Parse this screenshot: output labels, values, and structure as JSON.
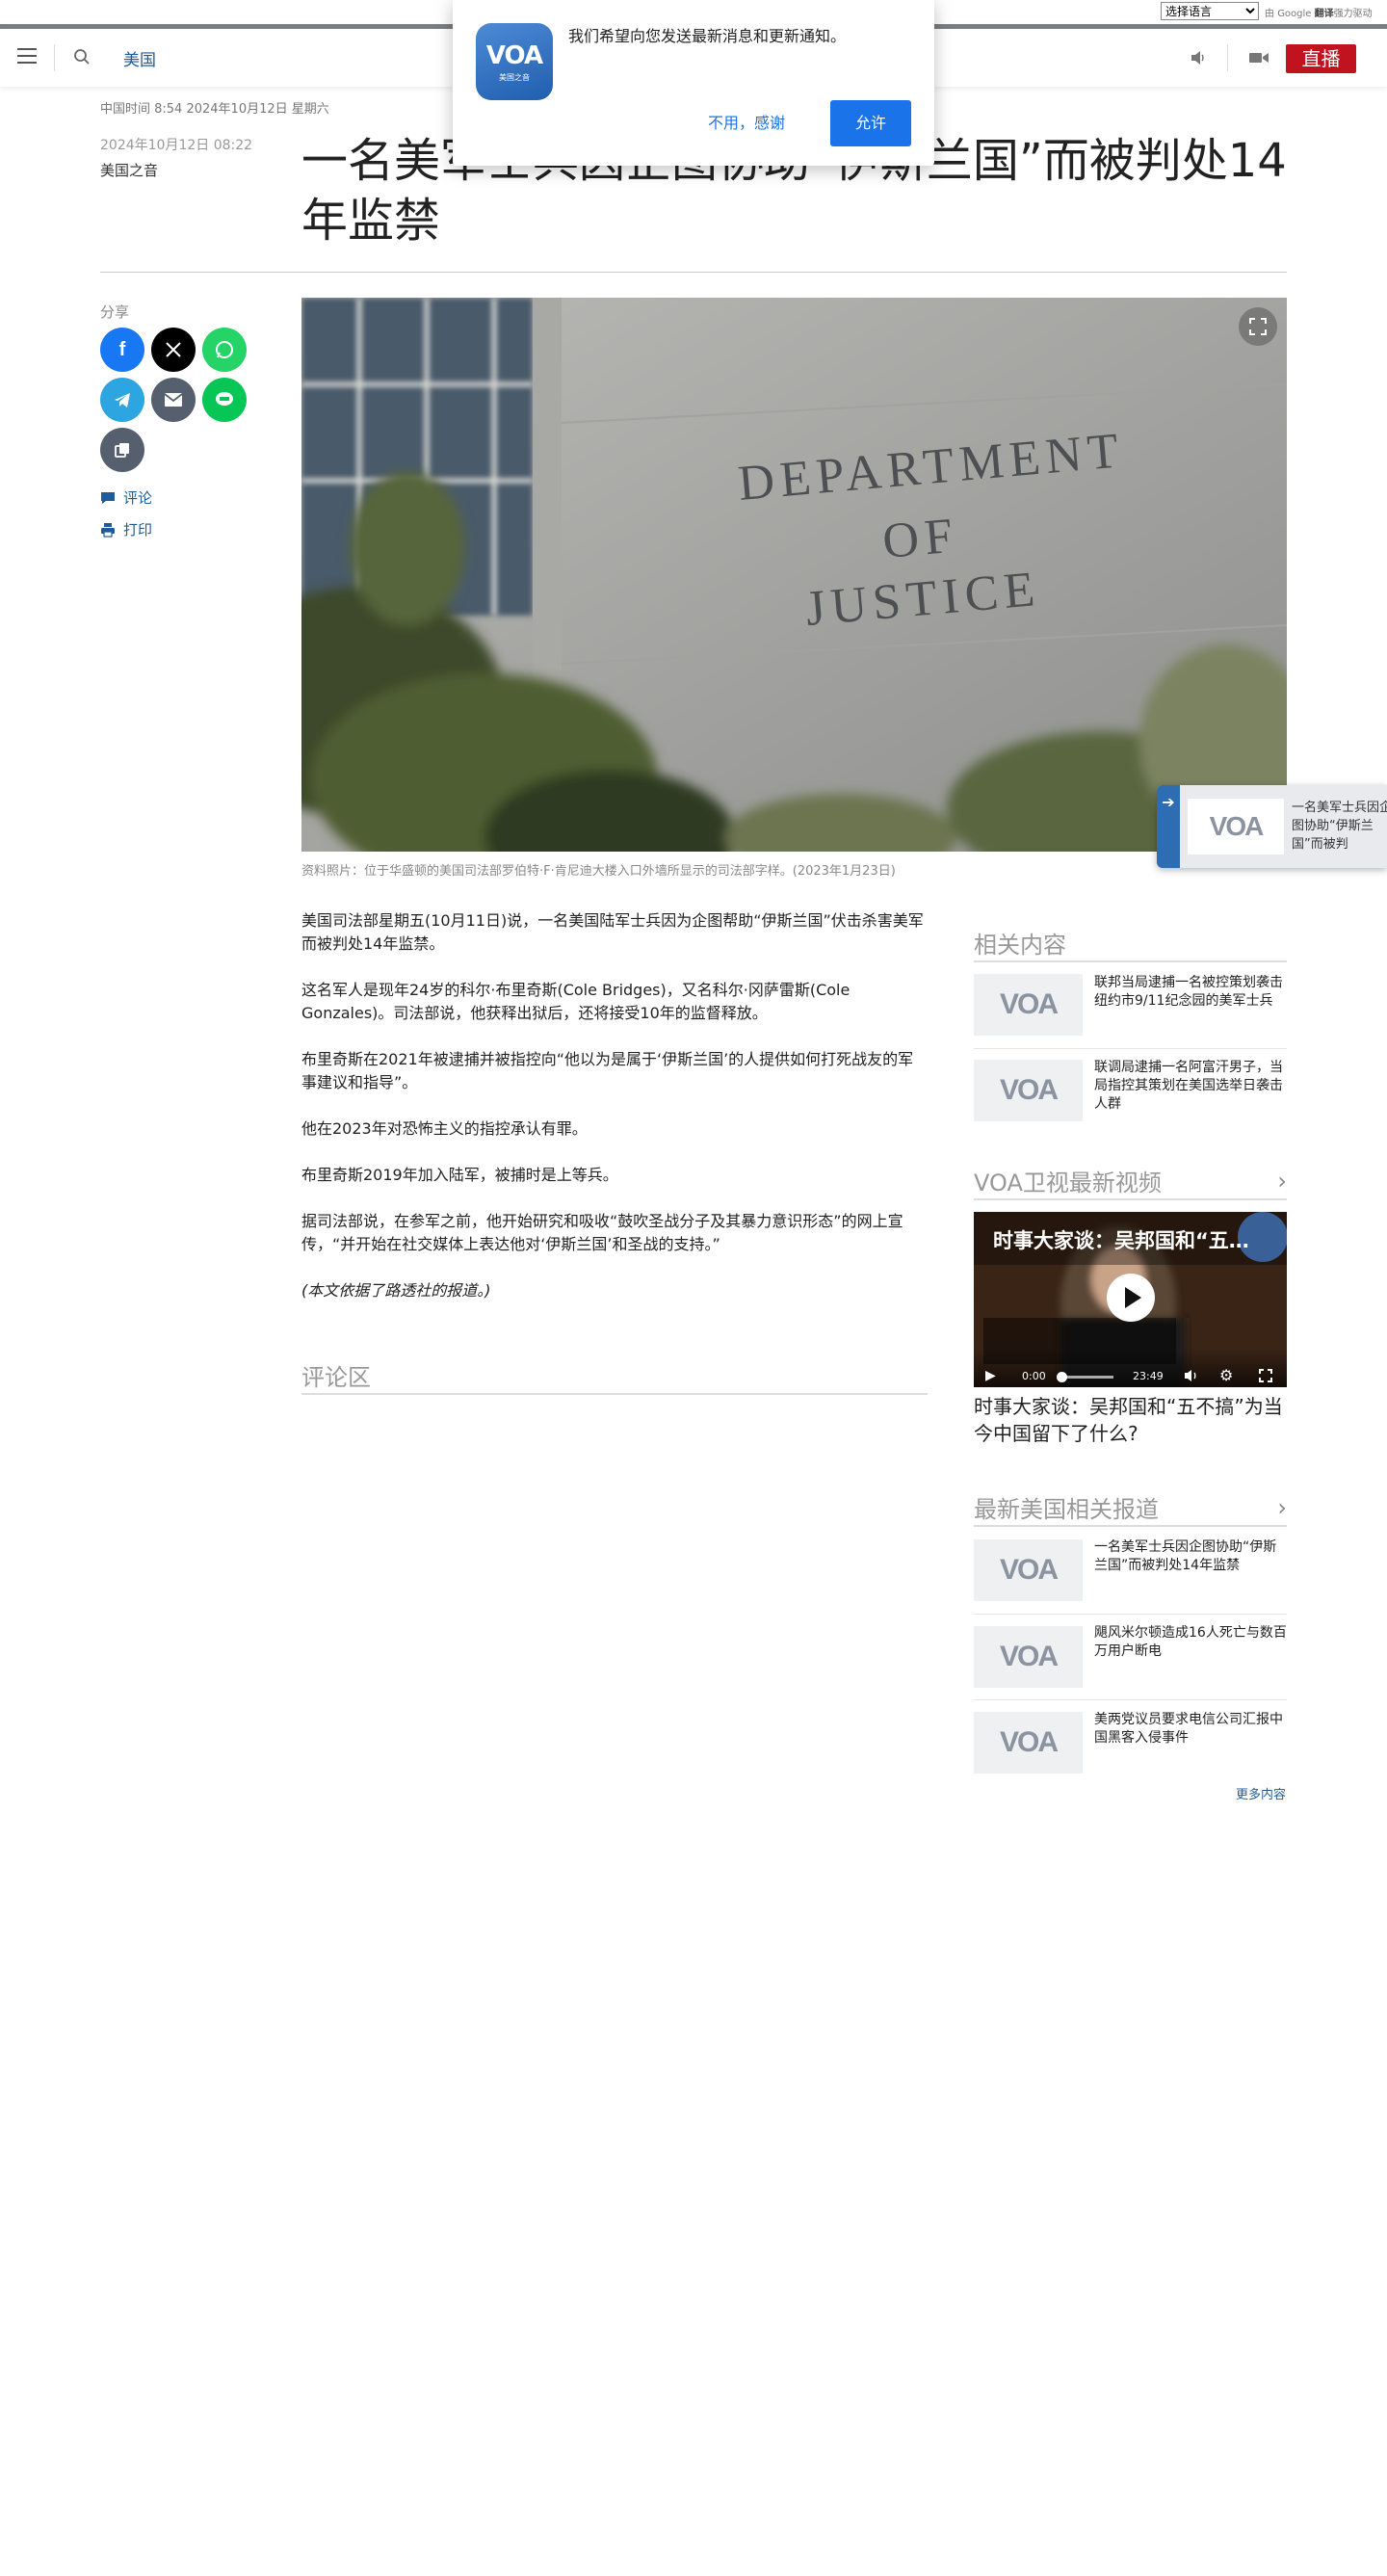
{
  "translate_bar": {
    "select_label": "选择语言",
    "powered_prefix": "由",
    "powered_brand": "Google",
    "powered_word": "翻译",
    "powered_suffix": "强力驱动"
  },
  "header": {
    "section": "美国",
    "live_label": "直播"
  },
  "notification": {
    "logo_text": "VOA",
    "logo_sub": "美国之音",
    "message": "我们希望向您发送最新消息和更新通知。",
    "deny_label": "不用，感谢",
    "allow_label": "允许"
  },
  "article": {
    "timeline": "中国时间 8:54 2024年10月12日 星期六",
    "date": "2024年10月12日 08:22",
    "byline": "美国之音",
    "headline": "一名美军士兵因企图协助“伊斯兰国”而被判处14年监禁",
    "hero_sign": [
      "DEPARTMENT",
      "OF",
      "JUSTICE"
    ],
    "caption": "资料照片：位于华盛顿的美国司法部罗伯特·F·肯尼迪大楼入口外墙所显示的司法部字样。(2023年1月23日)",
    "paragraphs": [
      "美国司法部星期五(10月11日)说，一名美国陆军士兵因为企图帮助“伊斯兰国”伏击杀害美军而被判处14年监禁。",
      "这名军人是现年24岁的科尔·布里奇斯(Cole Bridges)，又名科尔·冈萨雷斯(Cole Gonzales)。司法部说，他获释出狱后，还将接受10年的监督释放。",
      "布里奇斯在2021年被逮捕并被指控向“他以为是属于‘伊斯兰国’的人提供如何打死战友的军事建议和指导”。",
      "他在2023年对恐怖主义的指控承认有罪。",
      "布里奇斯2019年加入陆军，被捕时是上等兵。",
      "据司法部说，在参军之前，他开始研究和吸收“鼓吹圣战分子及其暴力意识形态”的网上宣传，“并开始在社交媒体上表达他对‘伊斯兰国’和圣战的支持。”",
      "(本文依据了路透社的报道。)"
    ],
    "comments_title": "评论区"
  },
  "share": {
    "label": "分享",
    "comment_label": "评论",
    "print_label": "打印"
  },
  "sidebar": {
    "thumb_logo": "VOA",
    "related": {
      "title": "相关内容",
      "items": [
        "联邦当局逮捕一名被控策划袭击纽约市9/11纪念园的美军士兵",
        "联调局逮捕一名阿富汗男子，当局指控其策划在美国选举日袭击人群"
      ]
    },
    "video_section": {
      "title": "VOA卫视最新视频",
      "overlay_title": "时事大家谈：吴邦国和“五…",
      "current_time": "0:00",
      "duration": "23:49",
      "caption": "时事大家谈：吴邦国和“五不搞”为当今中国留下了什么?"
    },
    "latest": {
      "title": "最新美国相关报道",
      "items": [
        "一名美军士兵因企图协助“伊斯兰国”而被判处14年监禁",
        "飓风米尔顿造成16人死亡与数百万用户断电",
        "美两党议员要求电信公司汇报中国黑客入侵事件"
      ],
      "more_label": "更多内容"
    }
  },
  "mini_player": {
    "logo": "VOA",
    "text": "一名美军士兵因企图协助“伊斯兰国”而被判"
  }
}
